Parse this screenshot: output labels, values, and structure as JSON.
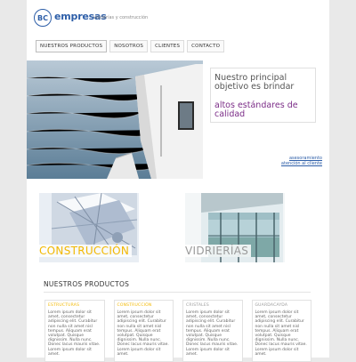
{
  "brand": {
    "mark": "BC",
    "name": "empresas",
    "tagline": "vidrierías y construcción"
  },
  "nav": {
    "items": [
      "NUESTROS PRODUCTOS",
      "NOSOTROS",
      "CLIENTES",
      "CONTACTO"
    ]
  },
  "hero": {
    "headline": "Nuestro principal objetivo es brindar",
    "highlight": "altos estándares de calidad",
    "links": [
      "asesoramiento",
      "atención al cliente"
    ]
  },
  "categories": [
    {
      "label": "CONSTRUCCIÓN",
      "color": "#f2b800"
    },
    {
      "label": "VIDRIERÍAS",
      "color": "#9a9a9a"
    }
  ],
  "products": {
    "title": "NUESTROS PRODUCTOS",
    "cards": [
      {
        "head": "ESTRUCTURAS",
        "color": "#f2b800",
        "body": "Lorem ipsum dolor sit amet, consectetur adipiscing elit. Curabitur non nulla sit amet nisl tempus. Aliquam erat volutpat. Quisque dignissim. Nulla nunc. Donec lacus mauris vitae. Lorem ipsum dolor sit amet."
      },
      {
        "head": "CONSTRUCCIÓN",
        "color": "#f2b800",
        "body": "Lorem ipsum dolor sit amet, consectetur adipiscing elit. Curabitur non nulla sit amet nisl tempus. Aliquam erat volutpat. Quisque dignissim. Nulla nunc. Donec lacus mauris vitae. Lorem ipsum dolor sit amet."
      },
      {
        "head": "CRISTALES",
        "color": "#9a9a9a",
        "body": "Lorem ipsum dolor sit amet, consectetur adipiscing elit. Curabitur non nulla sit amet nisl tempus. Aliquam erat volutpat. Quisque dignissim. Nulla nunc. Donec lacus mauris vitae. Lorem ipsum dolor sit amet."
      },
      {
        "head": "GUARDACAYDA",
        "color": "#9a9a9a",
        "body": "Lorem ipsum dolor sit amet, consectetur adipiscing elit. Curabitur non nulla sit amet nisl tempus. Aliquam erat volutpat. Quisque dignissim. Nulla nunc. Donec lacus mauris vitae. Lorem ipsum dolor sit amet."
      }
    ]
  }
}
